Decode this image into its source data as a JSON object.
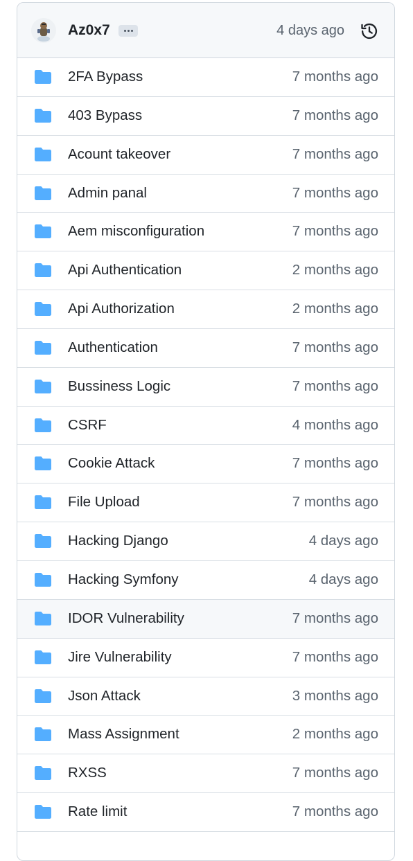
{
  "commit": {
    "author": "Az0x7",
    "time": "4 days ago",
    "more_icon": "ellipsis-icon",
    "history_icon": "history-icon"
  },
  "colors": {
    "folder": "#54aeff",
    "border": "#d0d7de",
    "header_bg": "#f6f8fa",
    "muted_text": "#59636e",
    "text": "#1f2328"
  },
  "files": [
    {
      "name": "2FA Bypass",
      "time": "7 months ago",
      "icon": "folder-icon"
    },
    {
      "name": "403 Bypass",
      "time": "7 months ago",
      "icon": "folder-icon"
    },
    {
      "name": "Acount takeover",
      "time": "7 months ago",
      "icon": "folder-icon"
    },
    {
      "name": "Admin panal",
      "time": "7 months ago",
      "icon": "folder-icon"
    },
    {
      "name": "Aem misconfiguration",
      "time": "7 months ago",
      "icon": "folder-icon"
    },
    {
      "name": "Api Authentication",
      "time": "2 months ago",
      "icon": "folder-icon"
    },
    {
      "name": "Api Authorization",
      "time": "2 months ago",
      "icon": "folder-icon"
    },
    {
      "name": "Authentication",
      "time": "7 months ago",
      "icon": "folder-icon"
    },
    {
      "name": "Bussiness Logic",
      "time": "7 months ago",
      "icon": "folder-icon"
    },
    {
      "name": "CSRF",
      "time": "4 months ago",
      "icon": "folder-icon"
    },
    {
      "name": "Cookie Attack",
      "time": "7 months ago",
      "icon": "folder-icon"
    },
    {
      "name": "File Upload",
      "time": "7 months ago",
      "icon": "folder-icon"
    },
    {
      "name": "Hacking Django",
      "time": "4 days ago",
      "icon": "folder-icon"
    },
    {
      "name": "Hacking Symfony",
      "time": "4 days ago",
      "icon": "folder-icon"
    },
    {
      "name": "IDOR Vulnerability",
      "time": "7 months ago",
      "icon": "folder-icon",
      "hovered": true
    },
    {
      "name": "Jire Vulnerability",
      "time": "7 months ago",
      "icon": "folder-icon"
    },
    {
      "name": "Json Attack",
      "time": "3 months ago",
      "icon": "folder-icon"
    },
    {
      "name": "Mass Assignment",
      "time": "2 months ago",
      "icon": "folder-icon"
    },
    {
      "name": "RXSS",
      "time": "7 months ago",
      "icon": "folder-icon"
    },
    {
      "name": "Rate limit",
      "time": "7 months ago",
      "icon": "folder-icon"
    }
  ]
}
